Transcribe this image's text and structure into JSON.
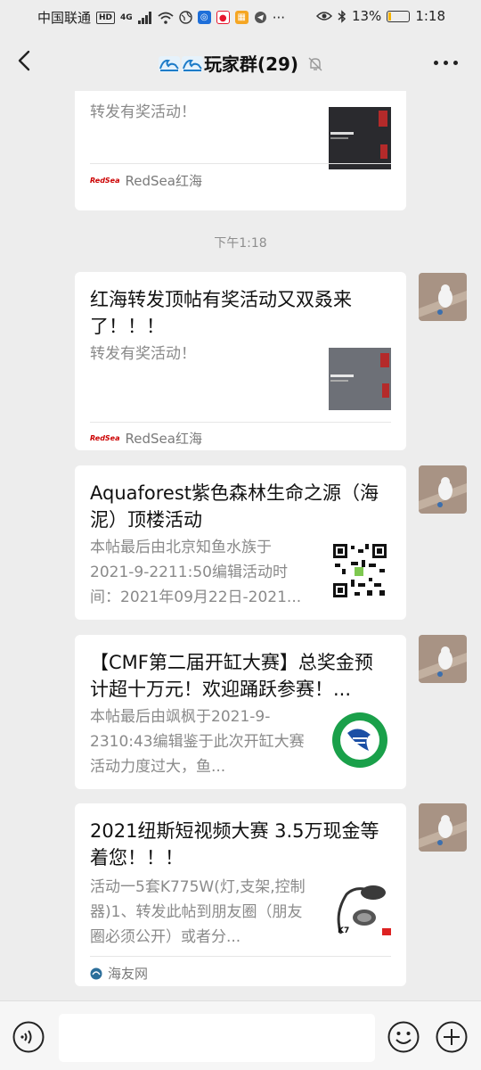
{
  "status_bar": {
    "carrier": "中国联通",
    "network_badge": "HD",
    "signal_type": "4G",
    "more_dots": "···",
    "battery_percent": "13%",
    "battery_level": 0.13,
    "time": "1:18"
  },
  "header": {
    "title": "玩家群(29)",
    "title_emoji": "wave-icon",
    "muted": true
  },
  "messages": {
    "card0": {
      "title_fragment": "",
      "desc": "转发有奖活动！",
      "source": "RedSea红海",
      "source_logo": "RedSea"
    },
    "timestamp": "下午1:18",
    "card1": {
      "title": "红海转发顶帖有奖活动又双叒来了！！！",
      "desc": "转发有奖活动！",
      "source": "RedSea红海",
      "source_logo": "RedSea"
    },
    "card2": {
      "title": "Aquaforest紫色森林生命之源（海泥）顶楼活动",
      "desc": "本帖最后由北京知鱼水族于2021-9-2211:50编辑活动时间：2021年09月22日-2021..."
    },
    "card3": {
      "title": "【CMF第二届开缸大赛】总奖金预计超十万元！欢迎踊跃参赛！...",
      "desc": "本帖最后由飒枫于2021-9-2310:43编辑鉴于此次开缸大赛活动力度过大，鱼..."
    },
    "card4": {
      "title": "2021纽斯短视频大赛 3.5万现金等着您！！！",
      "desc": "活动一5套K775W(灯,支架,控制器)1、转发此帖到朋友圈（朋友圈必须公开）或者分...",
      "source": "海友网",
      "thumb_label": "K7"
    }
  },
  "input_bar": {
    "placeholder": ""
  }
}
